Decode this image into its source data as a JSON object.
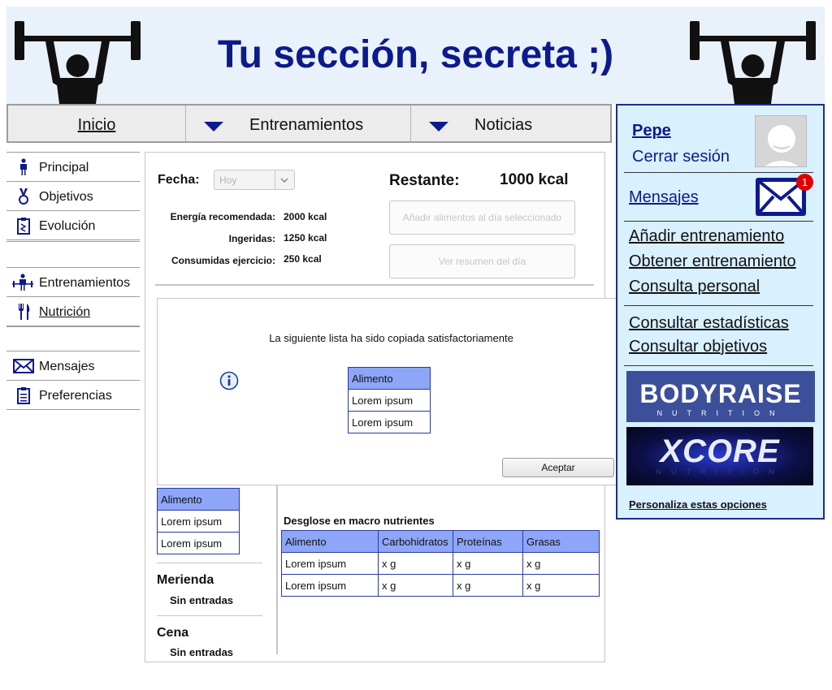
{
  "header": {
    "title": "Tu sección, secreta ;)"
  },
  "topnav": {
    "items": [
      {
        "label": "Inicio"
      },
      {
        "label": "Entrenamientos"
      },
      {
        "label": "Noticias"
      }
    ]
  },
  "sidebar": {
    "items": [
      {
        "label": "Principal",
        "icon": "person-icon"
      },
      {
        "label": "Objetivos",
        "icon": "medal-icon"
      },
      {
        "label": "Evolución",
        "icon": "clipboard-chart-icon"
      },
      {
        "label": "Entrenamientos",
        "icon": "dumbbell-person-icon"
      },
      {
        "label": "Nutrición",
        "icon": "fork-knife-icon"
      },
      {
        "label": "Mensajes",
        "icon": "envelope-icon"
      },
      {
        "label": "Preferencias",
        "icon": "clipboard-list-icon"
      }
    ]
  },
  "main": {
    "fecha_label": "Fecha:",
    "fecha_value": "Hoy",
    "restante_label": "Restante:",
    "restante_value": "1000 kcal",
    "stats": [
      {
        "label": "Energía recomendada:",
        "value": "2000 kcal"
      },
      {
        "label": "Ingeridas:",
        "value": "1250 kcal"
      },
      {
        "label": "Consumidas ejercicio:",
        "value": "250 kcal"
      }
    ],
    "add_food_button": "Añadir alimentos al día seleccionado",
    "summary_button": "Ver resumen del día",
    "food_table": {
      "header": "Alimento",
      "rows": [
        "Lorem ipsum",
        "Lorem ipsum"
      ]
    },
    "meals": [
      {
        "name": "Merienda",
        "status": "Sin entradas"
      },
      {
        "name": "Cena",
        "status": "Sin entradas"
      }
    ],
    "macro_title": "Desglose en macro nutrientes",
    "macro_table": {
      "headers": [
        "Alimento",
        "Carbohidratos",
        "Proteínas",
        "Grasas"
      ],
      "rows": [
        [
          "Lorem ipsum",
          "x g",
          "x g",
          "x g"
        ],
        [
          "Lorem ipsum",
          "x g",
          "x g",
          "x g"
        ]
      ]
    }
  },
  "dialog": {
    "message": "La siguiente lista ha sido copiada satisfactoriamente",
    "table": {
      "header": "Alimento",
      "rows": [
        "Lorem ipsum",
        "Lorem ipsum"
      ]
    },
    "accept_button": "Aceptar"
  },
  "rightbar": {
    "username": "Pepe",
    "logout": "Cerrar sesión",
    "messages": "Mensajes",
    "messages_badge": "1",
    "links_group1": [
      "Añadir entrenamiento",
      "Obtener entrenamiento",
      "Consulta personal"
    ],
    "links_group2": [
      "Consultar estadísticas",
      "Consultar objetivos"
    ],
    "ad1_title": "BODYRAISE",
    "ad1_sub": "NUTRITION",
    "ad2_title": "XCORE",
    "ad2_sub": "NUTRITION",
    "customize": "Personaliza estas opciones"
  },
  "colors": {
    "brand": "#0d1a8c",
    "header_bg": "#e9f1fa",
    "rightbar_bg": "#d9f0ff",
    "table_header": "#8ea6f8",
    "badge": "#e00000"
  }
}
